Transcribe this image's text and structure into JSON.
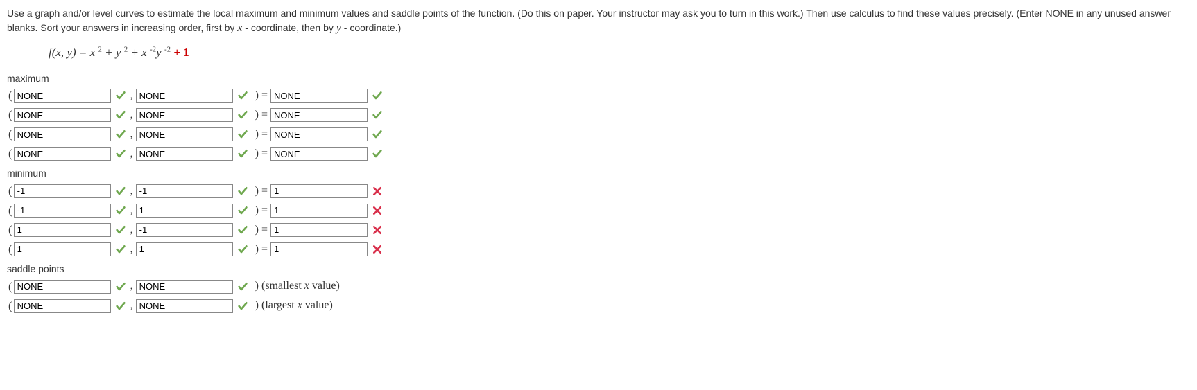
{
  "question": {
    "line1a": "Use a graph and/or level curves to estimate the local maximum and minimum values and saddle points of the function. (Do this on paper. Your instructor may ask you to turn in this work.) Then use calculus to find these values precisely. (Enter NONE in any unused answer blanks. Sort your answers in increasing order, first by ",
    "x": "x",
    "line1b": " - coordinate, then by ",
    "y": "y",
    "line1c": " - coordinate.)"
  },
  "formula": {
    "prefix": "f(x, y) = x",
    "sup1": "2",
    "mid1": " + y",
    "sup2": "2",
    "mid2": " + x",
    "sup3": "-2",
    "mid3": "y",
    "sup4": "-2",
    "plus1": " + 1"
  },
  "sections": {
    "maximum": {
      "label": "maximum",
      "rows": [
        {
          "x": "NONE",
          "xok": true,
          "y": "NONE",
          "yok": true,
          "v": "NONE",
          "vok": true
        },
        {
          "x": "NONE",
          "xok": true,
          "y": "NONE",
          "yok": true,
          "v": "NONE",
          "vok": true
        },
        {
          "x": "NONE",
          "xok": true,
          "y": "NONE",
          "yok": true,
          "v": "NONE",
          "vok": true
        },
        {
          "x": "NONE",
          "xok": true,
          "y": "NONE",
          "yok": true,
          "v": "NONE",
          "vok": true
        }
      ]
    },
    "minimum": {
      "label": "minimum",
      "rows": [
        {
          "x": "-1",
          "xok": true,
          "y": "-1",
          "yok": true,
          "v": "1",
          "vok": false
        },
        {
          "x": "-1",
          "xok": true,
          "y": "1",
          "yok": true,
          "v": "1",
          "vok": false
        },
        {
          "x": "1",
          "xok": true,
          "y": "-1",
          "yok": true,
          "v": "1",
          "vok": false
        },
        {
          "x": "1",
          "xok": true,
          "y": "1",
          "yok": true,
          "v": "1",
          "vok": false
        }
      ]
    },
    "saddle": {
      "label": "saddle points",
      "rows": [
        {
          "x": "NONE",
          "xok": true,
          "y": "NONE",
          "yok": true,
          "after_pre": "(smallest ",
          "after_x": "x",
          "after_post": " value)"
        },
        {
          "x": "NONE",
          "xok": true,
          "y": "NONE",
          "yok": true,
          "after_pre": "(largest ",
          "after_x": "x",
          "after_post": " value)"
        }
      ]
    }
  }
}
